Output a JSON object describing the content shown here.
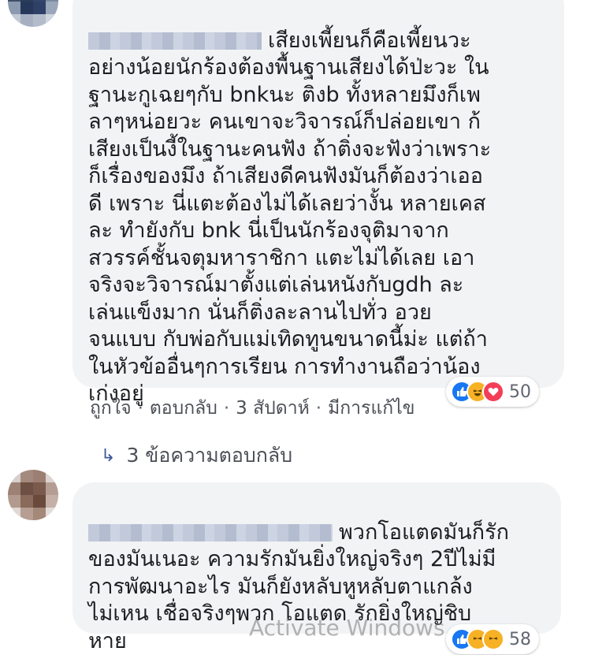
{
  "comments": [
    {
      "text": "เสียงเพี้ยนก็คือเพี้ยนวะ\nอย่างน้อยนักร้องต้องพื้นฐานเสียงได้ป่ะวะ ใน\nฐานะกูเฉยๆกับ bnkนะ ติงb ทั้งหลายมึงก็เพ\nลาๆหน่อยวะ คนเขาจะวิจารณ์ก็ปล่อยเขา ก้\nเสียงเป็นงี้ในฐานะคนฟัง ถ้าติ่งจะฟังว่าเพราะ\nก็เรื่องของมึง ถ้าเสียงดีคนฟังมันก็ต้องว่าเออ\nดี เพราะ นี่แตะต้องไม่ได้เลยว่างั้น หลายเคส\nละ ทำยังกับ bnk นี่เป็นนักร้องจุติมาจาก\nสวรรค์ชั้นจตุมหาราชิกา แตะไม่ได้เลย เอา\nจริงจะวิจารณ์มาตั้งแต่เล่นหนังกับgdh ละ\nเล่นแข็งมาก นั่นก็ติ่งละลานไปทั่ว อวย\nจนแบบ กับพ่อกับแม่เทิดทูนขนาดนี้ม่ะ แต่ถ้า\nในหัวข้ออื่นๆการเรียน การทำงานถือว่าน้อง\nเก่งอยู่",
      "reaction_count": "50",
      "like_label": "ถูกใจ",
      "reply_label": "ตอบกลับ",
      "time": "3 สัปดาห์",
      "edited": "มีการแก้ไข",
      "replies_label": "3 ข้อความตอบกลับ"
    },
    {
      "text": "พวกโอแตดมันก็รัก\nของมันเนอะ ความรักมันยิ่งใหญ่จริงๆ 2ปีไม่มี\nการพัฒนาอะไร มันก็ยังหลับหูหลับตาแกล้ง\nไม่เหน เชื่อจริงๆพวก โอแตด รักยิ่งใหญ่ชิบ\nหาย",
      "reaction_count": "58"
    }
  ],
  "watermark": "Activate Windows",
  "icons": {
    "like": "like-icon",
    "haha": "haha-icon",
    "love": "love-icon",
    "reply_arrow": "reply-arrow-icon"
  },
  "colors": {
    "bubble": "#f2f3f5",
    "like": "#1877f2",
    "love": "#f33e58",
    "haha": "#f7b125"
  }
}
